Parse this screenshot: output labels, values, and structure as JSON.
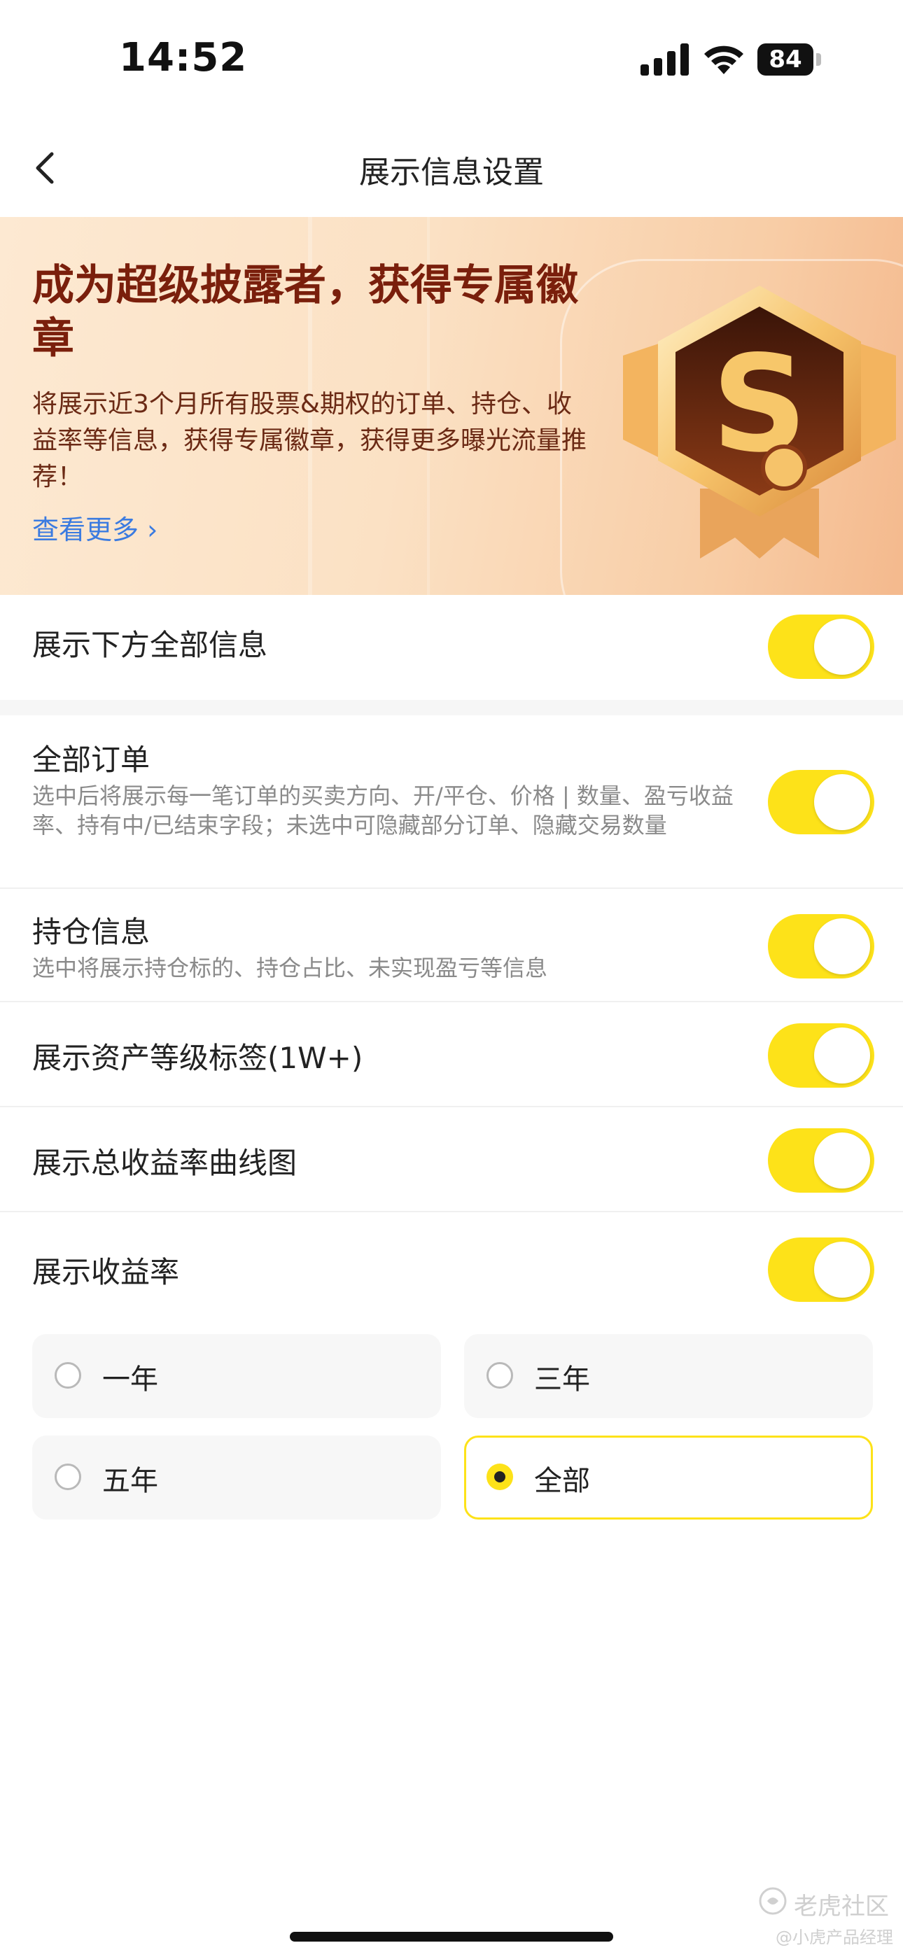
{
  "status_bar": {
    "time": "14:52",
    "battery": "84"
  },
  "nav": {
    "title": "展示信息设置"
  },
  "banner": {
    "title": "成为超级披露者，获得专属徽章",
    "description": "将展示近3个月所有股票&期权的订单、持仓、收益率等信息，获得专属徽章，获得更多曝光流量推荐！",
    "link": "查看更多",
    "badge_letter": "S"
  },
  "settings": {
    "show_all": {
      "label": "展示下方全部信息",
      "on": true
    },
    "all_orders": {
      "label": "全部订单",
      "desc": "选中后将展示每一笔订单的买卖方向、开/平仓、价格 | 数量、盈亏收益率、持有中/已结束字段；未选中可隐藏部分订单、隐藏交易数量",
      "on": true
    },
    "positions": {
      "label": "持仓信息",
      "desc": "选中将展示持仓标的、持仓占比、未实现盈亏等信息",
      "on": true
    },
    "asset_tag": {
      "label": "展示资产等级标签(1W+)",
      "on": true
    },
    "return_curve": {
      "label": "展示总收益率曲线图",
      "on": true
    },
    "return_rate": {
      "label": "展示收益率",
      "on": true
    }
  },
  "period_options": [
    {
      "label": "一年",
      "selected": false
    },
    {
      "label": "三年",
      "selected": false
    },
    {
      "label": "五年",
      "selected": false
    },
    {
      "label": "全部",
      "selected": true
    }
  ],
  "watermark": {
    "brand": "老虎社区",
    "author": "@小虎产品经理"
  },
  "colors": {
    "accent": "#fde219",
    "banner_title": "#7a1f0c",
    "link": "#3b7be0"
  }
}
